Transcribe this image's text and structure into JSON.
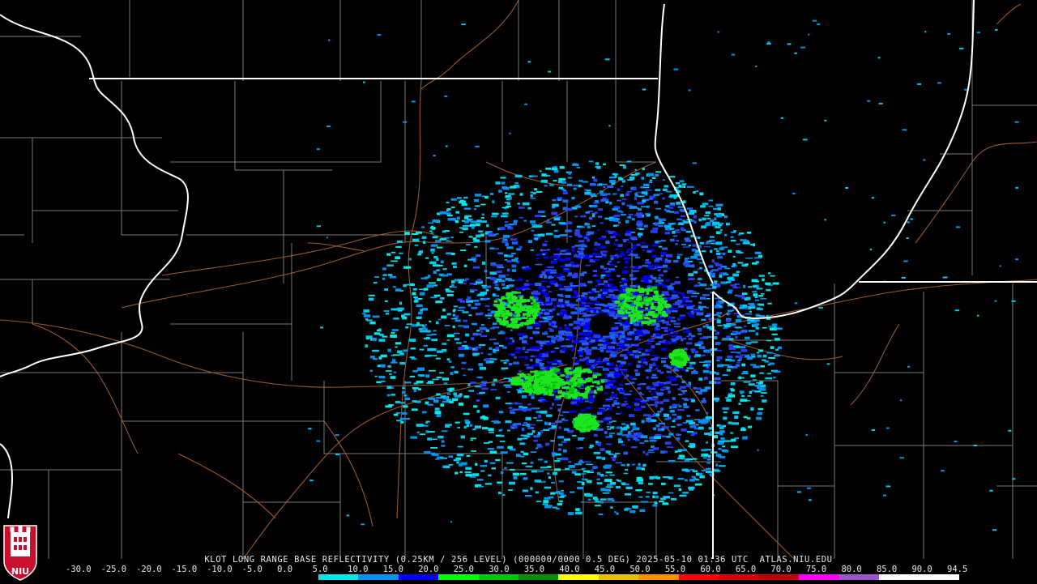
{
  "product_title": "KLOT LONG RANGE BASE REFLECTIVITY (0.25KM / 256 LEVEL) (000000/0000 0.5 DEG) 2025-05-10 01:36 UTC  ATLAS.NIU.EDU",
  "logo_text": "NIU",
  "scale": {
    "labels": [
      "-30.0",
      "-25.0",
      "-20.0",
      "-15.0",
      "-10.0",
      "-5.0",
      "0.0",
      "5.0",
      "10.0",
      "15.0",
      "20.0",
      "25.0",
      "30.0",
      "35.0",
      "40.0",
      "45.0",
      "50.0",
      "55.0",
      "60.0",
      "65.0",
      "70.0",
      "75.0",
      "80.0",
      "85.0",
      "90.0",
      "94.5"
    ],
    "colors": [
      "#000000",
      "#000000",
      "#000000",
      "#000000",
      "#000000",
      "#000000",
      "#00e8e8",
      "#0094f0",
      "#0000f6",
      "#00ff00",
      "#00c800",
      "#009000",
      "#ffff00",
      "#e7c000",
      "#ff9000",
      "#ff0000",
      "#d60000",
      "#c00000",
      "#ff00ff",
      "#9955c9",
      "#ffffff",
      "#ffffff"
    ]
  },
  "map": {
    "state_line_color": "#ffffff",
    "county_line_color": "#7a7a7a",
    "road_color": "#9a5a2a",
    "radar_site": "KLOT"
  }
}
